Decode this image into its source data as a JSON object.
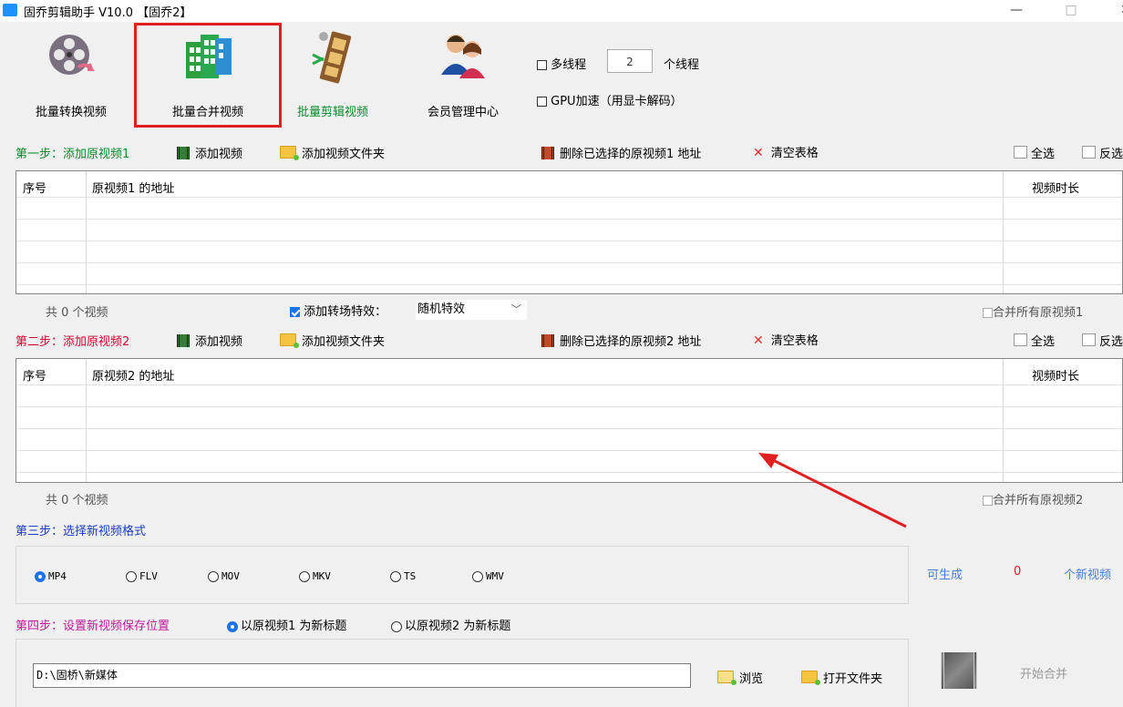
{
  "window": {
    "title": "固乔剪辑助手 V10.0 【固乔2】",
    "minimize": "—",
    "maximize": "□",
    "close": "✕"
  },
  "toolbar": {
    "batch_convert": "批量转换视频",
    "batch_merge": "批量合并视频",
    "batch_edit": "批量剪辑视频",
    "member_center": "会员管理中心",
    "multithread_label": "多线程",
    "thread_count": "2",
    "thread_unit": "个线程",
    "gpu_label": "GPU加速（用显卡解码）"
  },
  "step1": {
    "label": "第一步：添加原视频1",
    "add_video": "添加视频",
    "add_folder": "添加视频文件夹",
    "delete_selected": "删除已选择的原视频1 地址",
    "clear_table": "清空表格",
    "select_all": "全选",
    "invert": "反选",
    "col_index": "序号",
    "col_path": "原视频1 的地址",
    "col_duration": "视频时长",
    "count": "共 0 个视频",
    "merge_all": "合并所有原视频1"
  },
  "transition": {
    "label": "添加转场特效：",
    "value": "随机特效",
    "checked": true
  },
  "step2": {
    "label": "第二步：添加原视频2",
    "add_video": "添加视频",
    "add_folder": "添加视频文件夹",
    "delete_selected": "删除已选择的原视频2 地址",
    "clear_table": "清空表格",
    "select_all": "全选",
    "invert": "反选",
    "col_index": "序号",
    "col_path": "原视频2 的地址",
    "col_duration": "视频时长",
    "count": "共 0 个视频",
    "merge_all": "合并所有原视频2"
  },
  "step3": {
    "label": "第三步：选择新视频格式",
    "formats": [
      "MP4",
      "FLV",
      "MOV",
      "MKV",
      "TS",
      "WMV"
    ],
    "selected": "MP4",
    "can_generate": "可生成",
    "generate_count": "0",
    "generate_unit": "个新视频"
  },
  "step4": {
    "label": "第四步：设置新视频保存位置",
    "title_option1": "以原视频1 为新标题",
    "title_option2": "以原视频2 为新标题",
    "path": "D:\\固桥\\新媒体",
    "browse": "浏览",
    "open_folder": "打开文件夹",
    "start_merge": "开始合并"
  },
  "colors": {
    "accent_red": "#e02020",
    "step_blue": "#1a3cc8",
    "step_green": "#0a8a2a",
    "step_red": "#d9002f",
    "link_blue": "#4a7fd8"
  }
}
